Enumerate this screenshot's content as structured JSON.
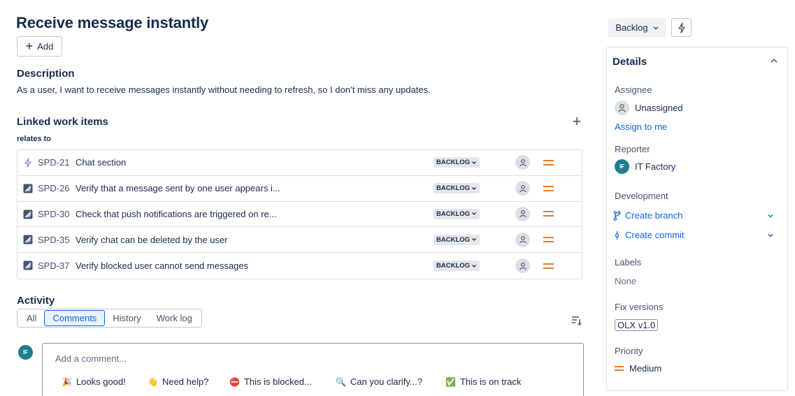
{
  "issue": {
    "title": "Receive message instantly",
    "add_label": "Add"
  },
  "description": {
    "heading": "Description",
    "text": "As a user, I want to receive messages instantly without needing to refresh, so I don’t miss any updates."
  },
  "linked": {
    "heading": "Linked work items",
    "relation": "relates to",
    "items": [
      {
        "type": "subtask-icon",
        "key": "SPD-21",
        "summary": "Chat section",
        "status": "BACKLOG",
        "priority": "medium"
      },
      {
        "type": "test-icon",
        "key": "SPD-26",
        "summary": "Verify that a message sent by one user appears i...",
        "status": "BACKLOG",
        "priority": "medium"
      },
      {
        "type": "test-icon",
        "key": "SPD-30",
        "summary": "Check that push notifications are triggered on re...",
        "status": "BACKLOG",
        "priority": "medium"
      },
      {
        "type": "test-icon",
        "key": "SPD-35",
        "summary": "Verify chat can be deleted by the user",
        "status": "BACKLOG",
        "priority": "medium"
      },
      {
        "type": "test-icon",
        "key": "SPD-37",
        "summary": "Verify blocked user cannot send messages",
        "status": "BACKLOG",
        "priority": "medium"
      }
    ]
  },
  "activity": {
    "heading": "Activity",
    "tabs": [
      {
        "label": "All",
        "active": false
      },
      {
        "label": "Comments",
        "active": true
      },
      {
        "label": "History",
        "active": false
      },
      {
        "label": "Work log",
        "active": false
      }
    ],
    "comment_avatar": "IF",
    "comment_placeholder": "Add a comment...",
    "quick_replies": [
      {
        "emoji": "🎉",
        "label": "Looks good!"
      },
      {
        "emoji": "👋",
        "label": "Need help?"
      },
      {
        "emoji": "⛔",
        "label": "This is blocked..."
      },
      {
        "emoji": "🔍",
        "label": "Can you clarify...?"
      },
      {
        "emoji": "✅",
        "label": "This is on track"
      }
    ]
  },
  "sidebar": {
    "status_label": "Backlog",
    "details_heading": "Details",
    "assignee_label": "Assignee",
    "assignee_value": "Unassigned",
    "assign_to_me": "Assign to me",
    "reporter_label": "Reporter",
    "reporter_initials": "IF",
    "reporter_value": "IT Factory",
    "development_label": "Development",
    "create_branch": "Create branch",
    "create_commit": "Create commit",
    "labels_label": "Labels",
    "labels_value": "None",
    "fix_versions_label": "Fix versions",
    "fix_version_value": "OLX v1.0",
    "priority_label": "Priority",
    "priority_value": "Medium"
  },
  "colors": {
    "accent": "#0c66e4",
    "priority_medium": "#e56910",
    "subtask_purple": "#8f7ee7"
  }
}
